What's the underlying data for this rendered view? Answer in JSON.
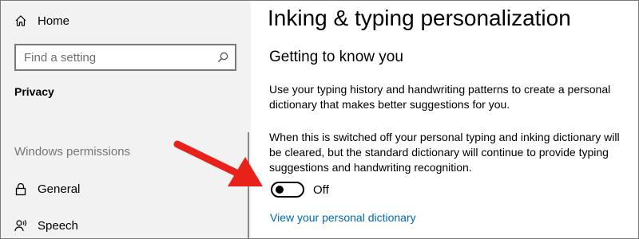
{
  "sidebar": {
    "home_label": "Home",
    "search": {
      "placeholder": "Find a setting"
    },
    "current_section": "Privacy",
    "group_header": "Windows permissions",
    "items": [
      {
        "label": "General",
        "icon": "lock-icon"
      },
      {
        "label": "Speech",
        "icon": "speech-icon"
      }
    ]
  },
  "main": {
    "title": "Inking & typing personalization",
    "subtitle": "Getting to know you",
    "description1": "Use your typing history and handwriting patterns to create a personal dictionary that makes better suggestions for you.",
    "description2": "When this is switched off your personal typing and inking dictionary will be cleared, but the standard dictionary will continue to provide typing suggestions and handwriting recognition.",
    "toggle": {
      "state_label": "Off",
      "on": false
    },
    "link_label": "View your personal dictionary"
  },
  "annotation": {
    "type": "arrow",
    "color": "#e8211b"
  },
  "colors": {
    "sidebar_bg": "#f2f2f2",
    "accent_link": "#0067b8",
    "muted_text": "#767676"
  }
}
